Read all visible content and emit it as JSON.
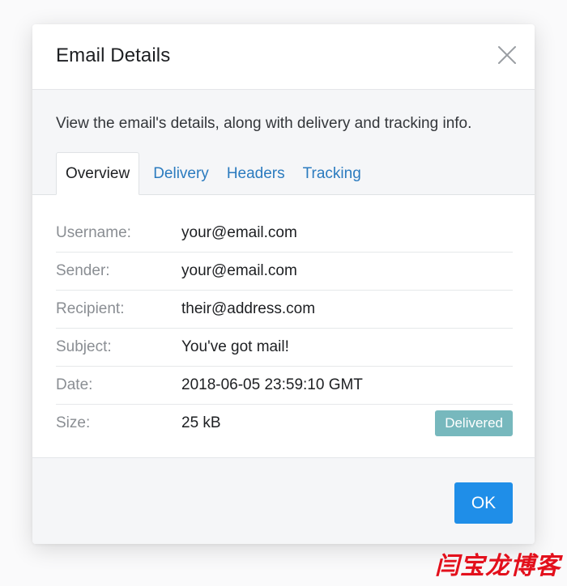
{
  "dialog": {
    "title": "Email Details",
    "description": "View the email's details, along with delivery and tracking info.",
    "close_icon": "close-icon"
  },
  "tabs": [
    {
      "label": "Overview",
      "active": true
    },
    {
      "label": "Delivery",
      "active": false
    },
    {
      "label": "Headers",
      "active": false
    },
    {
      "label": "Tracking",
      "active": false
    }
  ],
  "details": [
    {
      "label": "Username:",
      "value": "your@email.com"
    },
    {
      "label": "Sender:",
      "value": "your@email.com"
    },
    {
      "label": "Recipient:",
      "value": "their@address.com"
    },
    {
      "label": "Subject:",
      "value": "You've got mail!"
    },
    {
      "label": "Date:",
      "value": "2018-06-05 23:59:10 GMT"
    },
    {
      "label": "Size:",
      "value": "25 kB"
    }
  ],
  "status": {
    "label": "Delivered",
    "color": "#77b8bd"
  },
  "footer": {
    "ok_label": "OK"
  },
  "colors": {
    "accent": "#1f8ee8",
    "link": "#2b7bbf"
  },
  "watermark": "闫宝龙博客"
}
